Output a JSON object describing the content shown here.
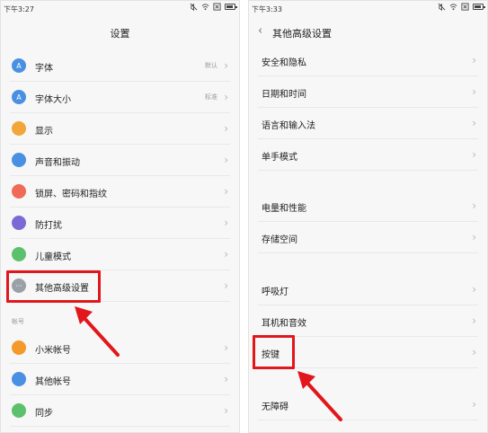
{
  "left": {
    "status_time": "下午3:27",
    "title": "设置",
    "rows": [
      {
        "label": "字体",
        "value": "默认",
        "icon": "font-icon",
        "color": "#4a90e2",
        "glyph": "A"
      },
      {
        "label": "字体大小",
        "value": "标准",
        "icon": "font-size-icon",
        "color": "#4a90e2",
        "glyph": "A"
      },
      {
        "label": "显示",
        "value": "",
        "icon": "display-icon",
        "color": "#f1a63a",
        "glyph": ""
      },
      {
        "label": "声音和振动",
        "value": "",
        "icon": "sound-icon",
        "color": "#4a90e2",
        "glyph": ""
      },
      {
        "label": "锁屏、密码和指纹",
        "value": "",
        "icon": "lock-icon",
        "color": "#f06a5a",
        "glyph": ""
      },
      {
        "label": "防打扰",
        "value": "",
        "icon": "do-not-disturb-icon",
        "color": "#7a6bd4",
        "glyph": ""
      },
      {
        "label": "儿童模式",
        "value": "",
        "icon": "child-mode-icon",
        "color": "#5cc16c",
        "glyph": ""
      },
      {
        "label": "其他高级设置",
        "value": "",
        "icon": "more-icon",
        "color": "#9aa0a6",
        "glyph": "···"
      }
    ],
    "section_label": "帐号",
    "account_rows": [
      {
        "label": "小米帐号",
        "icon": "mi-account-icon",
        "color": "#f39a2b",
        "glyph": ""
      },
      {
        "label": "其他帐号",
        "icon": "accounts-icon",
        "color": "#4a90e2",
        "glyph": ""
      },
      {
        "label": "同步",
        "icon": "sync-icon",
        "color": "#5cc16c",
        "glyph": ""
      }
    ]
  },
  "right": {
    "status_time": "下午3:33",
    "title": "其他高级设置",
    "rows": [
      {
        "label": "安全和隐私"
      },
      {
        "label": "日期和时间"
      },
      {
        "label": "语言和输入法"
      },
      {
        "label": "单手模式"
      },
      {
        "label": ""
      },
      {
        "label": "电量和性能"
      },
      {
        "label": "存储空间"
      },
      {
        "label": ""
      },
      {
        "label": "呼吸灯"
      },
      {
        "label": "耳机和音效"
      },
      {
        "label": "按键"
      },
      {
        "label": ""
      },
      {
        "label": "无障碍"
      }
    ]
  },
  "colors": {
    "highlight": "#e1171c"
  }
}
